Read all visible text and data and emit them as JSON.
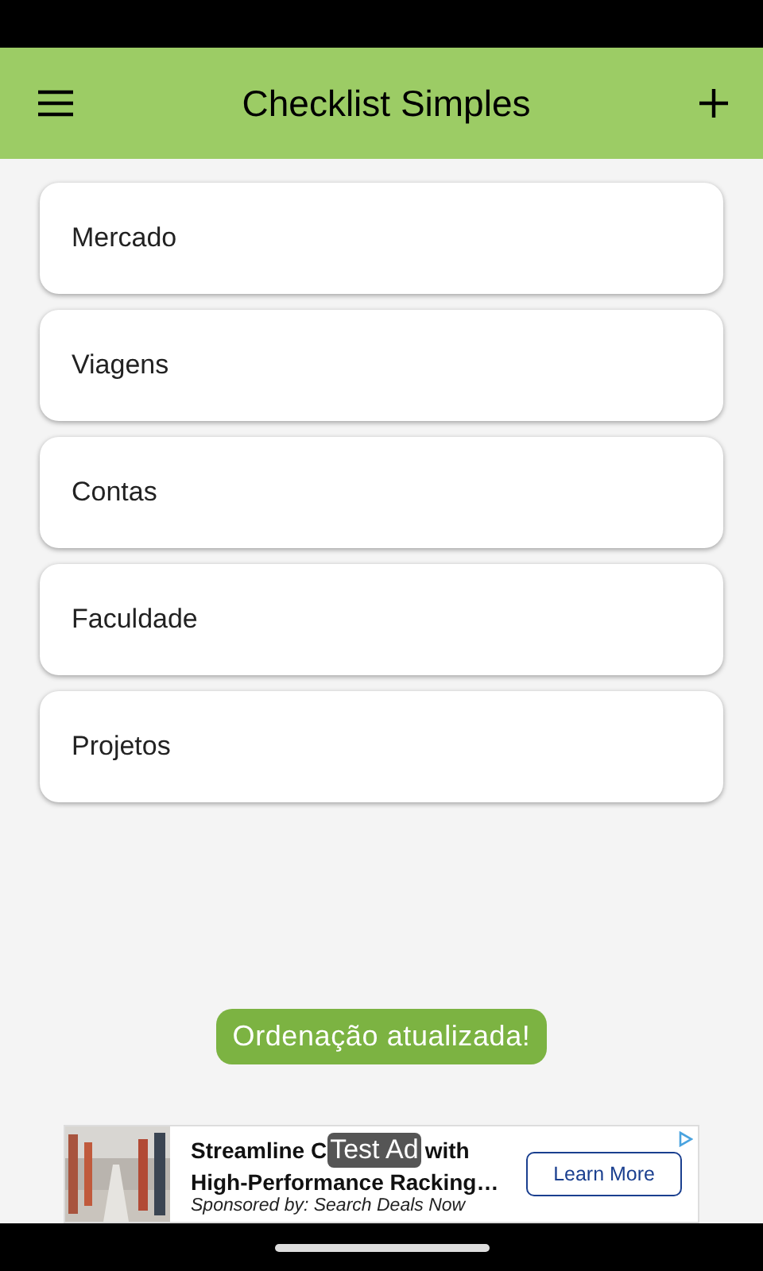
{
  "app_bar": {
    "title": "Checklist Simples"
  },
  "lists": [
    {
      "name": "Mercado"
    },
    {
      "name": "Viagens"
    },
    {
      "name": "Contas"
    },
    {
      "name": "Faculdade"
    },
    {
      "name": "Projetos"
    }
  ],
  "toast": "Ordenação atualizada!",
  "ad": {
    "kind": "picture",
    "headline_start": "Streamline C",
    "badge": "Test Ad",
    "headline_end": "with",
    "headline_line2": "High-Performance Racking…",
    "sponsor": "Sponsored by: Search Deals Now",
    "button": "Learn More"
  }
}
